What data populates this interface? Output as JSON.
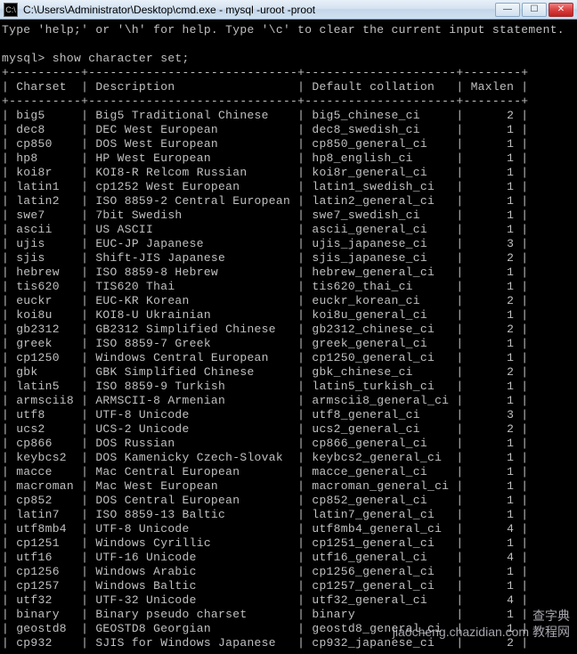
{
  "window": {
    "title": "C:\\Users\\Administrator\\Desktop\\cmd.exe - mysql  -uroot -proot",
    "icon_label": "C:\\"
  },
  "console": {
    "help_line": "Type 'help;' or '\\h' for help. Type '\\c' to clear the current input statement.",
    "prompt": "mysql> ",
    "command": "show character set;",
    "headers": [
      "Charset",
      "Description",
      "Default collation",
      "Maxlen"
    ],
    "rows": [
      {
        "c": "big5",
        "d": "Big5 Traditional Chinese",
        "dc": "big5_chinese_ci",
        "m": "2"
      },
      {
        "c": "dec8",
        "d": "DEC West European",
        "dc": "dec8_swedish_ci",
        "m": "1"
      },
      {
        "c": "cp850",
        "d": "DOS West European",
        "dc": "cp850_general_ci",
        "m": "1"
      },
      {
        "c": "hp8",
        "d": "HP West European",
        "dc": "hp8_english_ci",
        "m": "1"
      },
      {
        "c": "koi8r",
        "d": "KOI8-R Relcom Russian",
        "dc": "koi8r_general_ci",
        "m": "1"
      },
      {
        "c": "latin1",
        "d": "cp1252 West European",
        "dc": "latin1_swedish_ci",
        "m": "1"
      },
      {
        "c": "latin2",
        "d": "ISO 8859-2 Central European",
        "dc": "latin2_general_ci",
        "m": "1"
      },
      {
        "c": "swe7",
        "d": "7bit Swedish",
        "dc": "swe7_swedish_ci",
        "m": "1"
      },
      {
        "c": "ascii",
        "d": "US ASCII",
        "dc": "ascii_general_ci",
        "m": "1"
      },
      {
        "c": "ujis",
        "d": "EUC-JP Japanese",
        "dc": "ujis_japanese_ci",
        "m": "3"
      },
      {
        "c": "sjis",
        "d": "Shift-JIS Japanese",
        "dc": "sjis_japanese_ci",
        "m": "2"
      },
      {
        "c": "hebrew",
        "d": "ISO 8859-8 Hebrew",
        "dc": "hebrew_general_ci",
        "m": "1"
      },
      {
        "c": "tis620",
        "d": "TIS620 Thai",
        "dc": "tis620_thai_ci",
        "m": "1"
      },
      {
        "c": "euckr",
        "d": "EUC-KR Korean",
        "dc": "euckr_korean_ci",
        "m": "2"
      },
      {
        "c": "koi8u",
        "d": "KOI8-U Ukrainian",
        "dc": "koi8u_general_ci",
        "m": "1"
      },
      {
        "c": "gb2312",
        "d": "GB2312 Simplified Chinese",
        "dc": "gb2312_chinese_ci",
        "m": "2"
      },
      {
        "c": "greek",
        "d": "ISO 8859-7 Greek",
        "dc": "greek_general_ci",
        "m": "1"
      },
      {
        "c": "cp1250",
        "d": "Windows Central European",
        "dc": "cp1250_general_ci",
        "m": "1"
      },
      {
        "c": "gbk",
        "d": "GBK Simplified Chinese",
        "dc": "gbk_chinese_ci",
        "m": "2"
      },
      {
        "c": "latin5",
        "d": "ISO 8859-9 Turkish",
        "dc": "latin5_turkish_ci",
        "m": "1"
      },
      {
        "c": "armscii8",
        "d": "ARMSCII-8 Armenian",
        "dc": "armscii8_general_ci",
        "m": "1"
      },
      {
        "c": "utf8",
        "d": "UTF-8 Unicode",
        "dc": "utf8_general_ci",
        "m": "3"
      },
      {
        "c": "ucs2",
        "d": "UCS-2 Unicode",
        "dc": "ucs2_general_ci",
        "m": "2"
      },
      {
        "c": "cp866",
        "d": "DOS Russian",
        "dc": "cp866_general_ci",
        "m": "1"
      },
      {
        "c": "keybcs2",
        "d": "DOS Kamenicky Czech-Slovak",
        "dc": "keybcs2_general_ci",
        "m": "1"
      },
      {
        "c": "macce",
        "d": "Mac Central European",
        "dc": "macce_general_ci",
        "m": "1"
      },
      {
        "c": "macroman",
        "d": "Mac West European",
        "dc": "macroman_general_ci",
        "m": "1"
      },
      {
        "c": "cp852",
        "d": "DOS Central European",
        "dc": "cp852_general_ci",
        "m": "1"
      },
      {
        "c": "latin7",
        "d": "ISO 8859-13 Baltic",
        "dc": "latin7_general_ci",
        "m": "1"
      },
      {
        "c": "utf8mb4",
        "d": "UTF-8 Unicode",
        "dc": "utf8mb4_general_ci",
        "m": "4"
      },
      {
        "c": "cp1251",
        "d": "Windows Cyrillic",
        "dc": "cp1251_general_ci",
        "m": "1"
      },
      {
        "c": "utf16",
        "d": "UTF-16 Unicode",
        "dc": "utf16_general_ci",
        "m": "4"
      },
      {
        "c": "cp1256",
        "d": "Windows Arabic",
        "dc": "cp1256_general_ci",
        "m": "1"
      },
      {
        "c": "cp1257",
        "d": "Windows Baltic",
        "dc": "cp1257_general_ci",
        "m": "1"
      },
      {
        "c": "utf32",
        "d": "UTF-32 Unicode",
        "dc": "utf32_general_ci",
        "m": "4"
      },
      {
        "c": "binary",
        "d": "Binary pseudo charset",
        "dc": "binary",
        "m": "1"
      },
      {
        "c": "geostd8",
        "d": "GEOSTD8 Georgian",
        "dc": "geostd8_general_ci",
        "m": "1"
      },
      {
        "c": "cp932",
        "d": "SJIS for Windows Japanese",
        "dc": "cp932_japanese_ci",
        "m": "2"
      }
    ]
  },
  "watermark": {
    "line1": "查字典",
    "line2": "jiaocheng.chazidian.com 教程网"
  }
}
